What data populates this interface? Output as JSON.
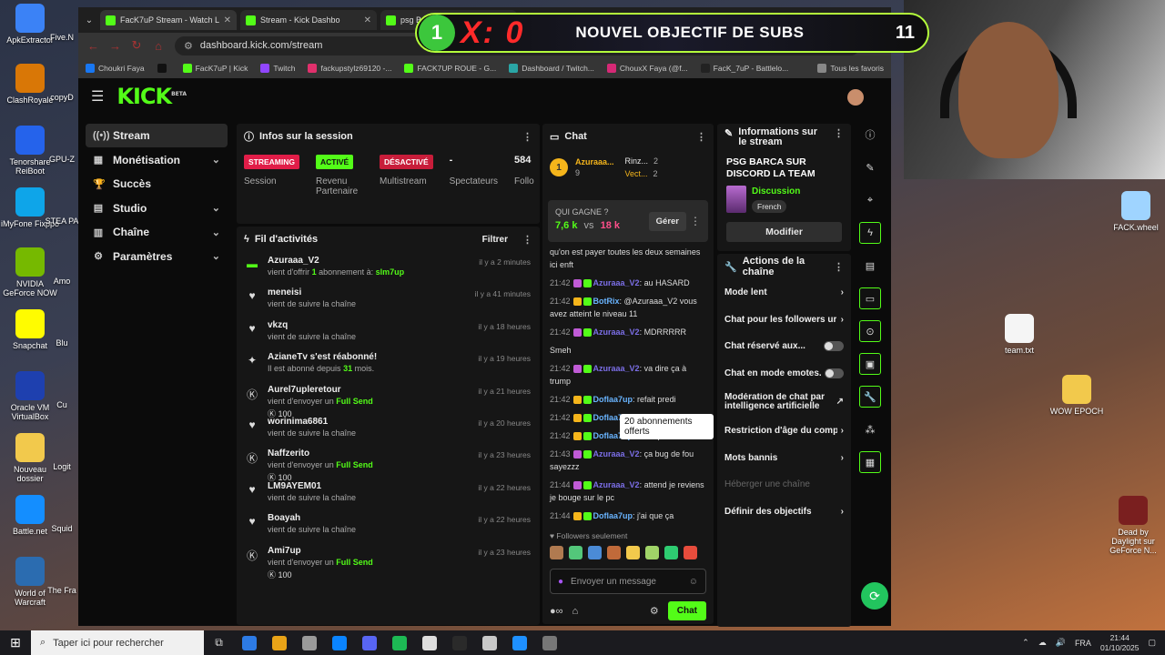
{
  "desktop_left": [
    {
      "label": "ApkExtractor",
      "color": "#3b82f6"
    },
    {
      "label": "ClashRoyale",
      "color": "#d97706"
    },
    {
      "label": "Tenorshare ReiBoot",
      "color": "#2563eb"
    },
    {
      "label": "iMyFone Fixppo",
      "color": "#0ea5e9"
    },
    {
      "label": "NVIDIA GeForce NOW",
      "color": "#76b900"
    },
    {
      "label": "Snapchat",
      "color": "#fffc00"
    },
    {
      "label": "Oracle VM VirtualBox",
      "color": "#1e40af"
    },
    {
      "label": "Nouveau dossier",
      "color": "#f2c94c"
    },
    {
      "label": "Battle.net",
      "color": "#148eff"
    },
    {
      "label": "World of Warcraft",
      "color": "#2b6cb0"
    }
  ],
  "desktop_left2": [
    "Five.N",
    "copyD",
    "GPU-Z",
    "STEA PA",
    "Amo",
    "Blu",
    "Cu",
    "Logit",
    "Squid",
    "The Fra"
  ],
  "desktop_right": [
    {
      "label": "FACK.wheel",
      "color": "#9fd4ff"
    },
    {
      "label": "team.txt",
      "color": "#f5f5f5"
    },
    {
      "label": "WOW EPOCH",
      "color": "#f2c94c"
    },
    {
      "label": "Dead by Daylight sur GeForce N...",
      "color": "#7a1f1f"
    }
  ],
  "browser": {
    "tabs": [
      {
        "label": "FacK7uP Stream - Watch Live o",
        "active": true
      },
      {
        "label": "Stream - Kick Dashbo",
        "active": false
      },
      {
        "label": "psg Barcelone - Recherche G",
        "active": false
      }
    ],
    "url": "dashboard.kick.com/stream",
    "bookmarks": [
      "Choukri Faya",
      "",
      "FacK7uP | Kick",
      "Twitch",
      "fackupstylz69120 -...",
      "FACK7UP ROUE - G...",
      "Dashboard / Twitch...",
      "ChouxX Faya (@f...",
      "FacK_7uP - Battlelo...",
      "Tous les favoris"
    ]
  },
  "banner": {
    "left_num": "1",
    "score": "X: 0",
    "goal": "NOUVEL OBJECTIF DE SUBS",
    "count": "11"
  },
  "kick": {
    "logo": "KICK",
    "logo_sup": "BETA",
    "nav": [
      {
        "label": "Stream",
        "icon": "broadcast-icon",
        "glyph": "((•))",
        "active": true,
        "chevron": false
      },
      {
        "label": "Monétisation",
        "icon": "money-icon",
        "glyph": "▦",
        "active": false,
        "chevron": true
      },
      {
        "label": "Succès",
        "icon": "trophy-icon",
        "glyph": "🏆",
        "active": false,
        "chevron": false
      },
      {
        "label": "Studio",
        "icon": "studio-icon",
        "glyph": "▤",
        "active": false,
        "chevron": true
      },
      {
        "label": "Chaîne",
        "icon": "channel-icon",
        "glyph": "▥",
        "active": false,
        "chevron": true
      },
      {
        "label": "Paramètres",
        "icon": "gear-icon",
        "glyph": "⚙",
        "active": false,
        "chevron": true
      }
    ],
    "session": {
      "title": "Infos sur la session",
      "stats": [
        {
          "badge": "STREAMING",
          "label": "Session",
          "style": "b-red"
        },
        {
          "badge": "ACTIVÉ",
          "label": "Revenu Partenaire",
          "style": "b-green"
        },
        {
          "badge": "DÉSACTIVÉ",
          "label": "Multistream",
          "style": "b-red2"
        },
        {
          "badge": "-",
          "label": "Spectateurs",
          "style": "plain"
        },
        {
          "badge": "584",
          "label": "Follo",
          "style": "plain"
        }
      ]
    },
    "activity": {
      "title": "Fil d'activités",
      "filter": "Filtrer",
      "items": [
        {
          "icon": "gift-icon",
          "glyph": "▬",
          "iconColor": "#53fc18",
          "name": "Azuraaa_V2",
          "pre": "vient d'offrir ",
          "hl": "1",
          "post": " abonnement à: ",
          "hl2": "slm7up",
          "time": "il y a 2 minutes",
          "amount": ""
        },
        {
          "icon": "heart-icon",
          "glyph": "♥",
          "iconColor": "#ddd",
          "name": "meneisi",
          "pre": "vient de suivre la chaîne",
          "hl": "",
          "post": "",
          "hl2": "",
          "time": "il y a 41 minutes",
          "amount": ""
        },
        {
          "icon": "heart-icon",
          "glyph": "♥",
          "iconColor": "#ddd",
          "name": "vkzq",
          "pre": "vient de suivre la chaîne",
          "hl": "",
          "post": "",
          "hl2": "",
          "time": "il y a 18 heures",
          "amount": ""
        },
        {
          "icon": "star-icon",
          "glyph": "✦",
          "iconColor": "#ddd",
          "name": "AzianeTv s'est réabonné!",
          "pre": "Il est abonné depuis ",
          "hl": "31",
          "post": " mois.",
          "hl2": "",
          "time": "il y a 19 heures",
          "amount": ""
        },
        {
          "icon": "kick-coin-icon",
          "glyph": "Ⓚ",
          "iconColor": "#ddd",
          "name": "Aurel7upleretour",
          "pre": "vient d'envoyer un ",
          "hl": "",
          "post": "",
          "hl2": "Full Send",
          "time": "il y a 21 heures",
          "amount": "100"
        },
        {
          "icon": "heart-icon",
          "glyph": "♥",
          "iconColor": "#ddd",
          "name": "worinima6861",
          "pre": "vient de suivre la chaîne",
          "hl": "",
          "post": "",
          "hl2": "",
          "time": "il y a 20 heures",
          "amount": ""
        },
        {
          "icon": "kick-coin-icon",
          "glyph": "Ⓚ",
          "iconColor": "#ddd",
          "name": "Naffzerito",
          "pre": "vient d'envoyer un ",
          "hl": "",
          "post": "",
          "hl2": "Full Send",
          "time": "il y a 23 heures",
          "amount": "100"
        },
        {
          "icon": "heart-icon",
          "glyph": "♥",
          "iconColor": "#ddd",
          "name": "LM9AYEM01",
          "pre": "vient de suivre la chaîne",
          "hl": "",
          "post": "",
          "hl2": "",
          "time": "il y a 22 heures",
          "amount": ""
        },
        {
          "icon": "heart-icon",
          "glyph": "♥",
          "iconColor": "#ddd",
          "name": "Boayah",
          "pre": "vient de suivre la chaîne",
          "hl": "",
          "post": "",
          "hl2": "",
          "time": "il y a 22 heures",
          "amount": ""
        },
        {
          "icon": "kick-coin-icon",
          "glyph": "Ⓚ",
          "iconColor": "#ddd",
          "name": "Ami7up",
          "pre": "vient d'envoyer un ",
          "hl": "",
          "post": "",
          "hl2": "Full Send",
          "time": "il y a 23 heures",
          "amount": "100"
        }
      ]
    },
    "chat": {
      "title": "Chat",
      "donors": [
        {
          "rank": "1",
          "name": "Azuraaa...",
          "value": "9"
        },
        {
          "name": "Rinz...",
          "value": "2"
        },
        {
          "name": "Vect...",
          "value": "2"
        }
      ],
      "prediction": {
        "question": "QUI GAGNE ?",
        "left": "7,6 k",
        "vs": "vs",
        "right": "18 k",
        "button": "Gérer"
      },
      "tooltip": "20 abonnements offerts",
      "messages": [
        {
          "time": "",
          "user": "",
          "text": "qu'on est payer toutes les deux semaines ici enft",
          "ucls": "u"
        },
        {
          "time": "21:42",
          "user": "Azuraaa_V2",
          "text": ": au HASARD",
          "ucls": "u"
        },
        {
          "time": "21:42",
          "user": "BotRix",
          "text": ": @Azuraaa_V2 vous avez atteint le niveau 11",
          "ucls": "u2"
        },
        {
          "time": "21:42",
          "user": "Azuraaa_V2",
          "text": ": MDRRRRR",
          "ucls": "u"
        },
        {
          "time": "",
          "user": "",
          "text": "Smeh",
          "ucls": "u"
        },
        {
          "time": "21:42",
          "user": "Azuraaa_V2",
          "text": ": va dire ça à trump",
          "ucls": "u"
        },
        {
          "time": "21:42",
          "user": "Doflaa7up",
          "text": ": refait predi",
          "ucls": "u2"
        },
        {
          "time": "21:42",
          "user": "Doflaa7up",
          "text": ": refait predi",
          "ucls": "u2"
        },
        {
          "time": "21:42",
          "user": "Doflaa7up",
          "text": ": refait predi",
          "ucls": "u2"
        },
        {
          "time": "21:43",
          "user": "Azuraaa_V2",
          "text": ": ça bug de fou sayezzz",
          "ucls": "u"
        },
        {
          "time": "21:44",
          "user": "Azuraaa_V2",
          "text": ": attend je reviens je bouge sur le pc",
          "ucls": "u"
        },
        {
          "time": "21:44",
          "user": "Doflaa7up",
          "text": ": j'ai que ça",
          "ucls": "u2"
        }
      ],
      "followers_only": "Followers seulement",
      "emote_colors": [
        "#b07a50",
        "#53c77a",
        "#4b8bd6",
        "#c06a3a",
        "#f2c94c",
        "#a0d468",
        "#2ecc71",
        "#e74c3c"
      ],
      "input_placeholder": "Envoyer un message",
      "send": "Chat"
    },
    "info": {
      "title": "Informations sur le stream",
      "stream_title": "PSG BARCA SUR DISCORD LA TEAM",
      "category": "Discussion",
      "language": "French",
      "modify": "Modifier"
    },
    "actions": {
      "title": "Actions de la chaîne",
      "items": [
        {
          "label": "Mode lent",
          "type": "chev"
        },
        {
          "label": "Chat pour les followers ur",
          "type": "chev"
        },
        {
          "label": "Chat réservé aux...",
          "type": "toggle"
        },
        {
          "label": "Chat en mode emotes...",
          "type": "toggle"
        },
        {
          "label": "Modération de chat par intelligence artificielle",
          "type": "ext"
        },
        {
          "label": "Restriction d'âge du comp",
          "type": "chev"
        },
        {
          "label": "Mots bannis",
          "type": "chev"
        },
        {
          "label": "Héberger une chaîne",
          "type": "dim"
        },
        {
          "label": "Définir des objectifs",
          "type": "chev"
        }
      ]
    },
    "rail": [
      {
        "name": "info-icon",
        "glyph": "ⓘ",
        "boxed": false
      },
      {
        "name": "edit-icon",
        "glyph": "✎",
        "boxed": false
      },
      {
        "name": "target-icon",
        "glyph": "⌖",
        "boxed": false
      },
      {
        "name": "bolt-icon",
        "glyph": "ϟ",
        "boxed": true
      },
      {
        "name": "doc-icon",
        "glyph": "▤",
        "boxed": false
      },
      {
        "name": "chat-bubble-icon",
        "glyph": "▭",
        "boxed": true
      },
      {
        "name": "broadcast-icon",
        "glyph": "⊙",
        "boxed": true
      },
      {
        "name": "layout-icon",
        "glyph": "▣",
        "boxed": true
      },
      {
        "name": "wrench-icon",
        "glyph": "🔧",
        "boxed": true
      },
      {
        "name": "nodes-icon",
        "glyph": "⁂",
        "boxed": false
      },
      {
        "name": "grid-icon",
        "glyph": "▦",
        "boxed": true
      }
    ]
  },
  "taskbar": {
    "search_placeholder": "Taper ici pour rechercher",
    "apps": [
      "#2d7be5",
      "#e8a317",
      "#9a9a9a",
      "#0a84ff",
      "#5865f2",
      "#1db954",
      "#ddd",
      "#2a2a2a",
      "#c8c8c8",
      "#1e90ff",
      "#777"
    ],
    "lang": "FRA",
    "time": "21:44",
    "date": "01/10/2025"
  }
}
